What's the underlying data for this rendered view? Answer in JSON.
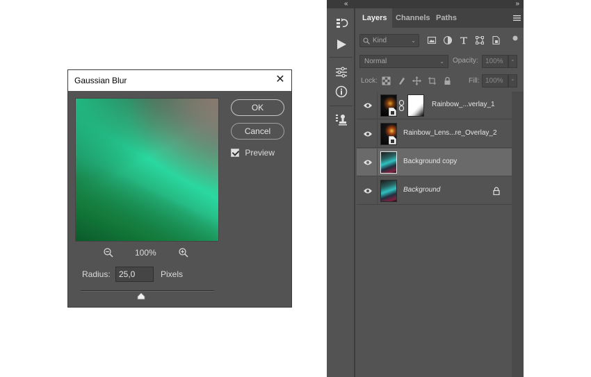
{
  "dialog": {
    "title": "Gaussian Blur",
    "ok_label": "OK",
    "cancel_label": "Cancel",
    "preview_label": "Preview",
    "preview_checked": true,
    "zoom_value": "100%",
    "radius_label": "Radius:",
    "radius_value": "25,0",
    "radius_unit": "Pixels"
  },
  "panel": {
    "tabs": [
      {
        "label": "Layers",
        "active": true
      },
      {
        "label": "Channels",
        "active": false
      },
      {
        "label": "Paths",
        "active": false
      }
    ],
    "filter_kind": "Kind",
    "blend_mode": "Normal",
    "opacity_label": "Opacity:",
    "opacity_value": "100%",
    "lock_label": "Lock:",
    "fill_label": "Fill:",
    "fill_value": "100%",
    "layers": [
      {
        "name": "Rainbow_...verlay_1",
        "italic": false,
        "selected": false,
        "locked": false
      },
      {
        "name": "Rainbow_Lens...re_Overlay_2",
        "italic": false,
        "selected": false,
        "locked": false
      },
      {
        "name": "Background copy",
        "italic": false,
        "selected": true,
        "locked": false
      },
      {
        "name": "Background",
        "italic": true,
        "selected": false,
        "locked": true
      }
    ]
  },
  "colors": {
    "panel_bg": "#535353",
    "selected_layer": "#6a6a6a",
    "dialog_title_bg": "#ffffff"
  }
}
